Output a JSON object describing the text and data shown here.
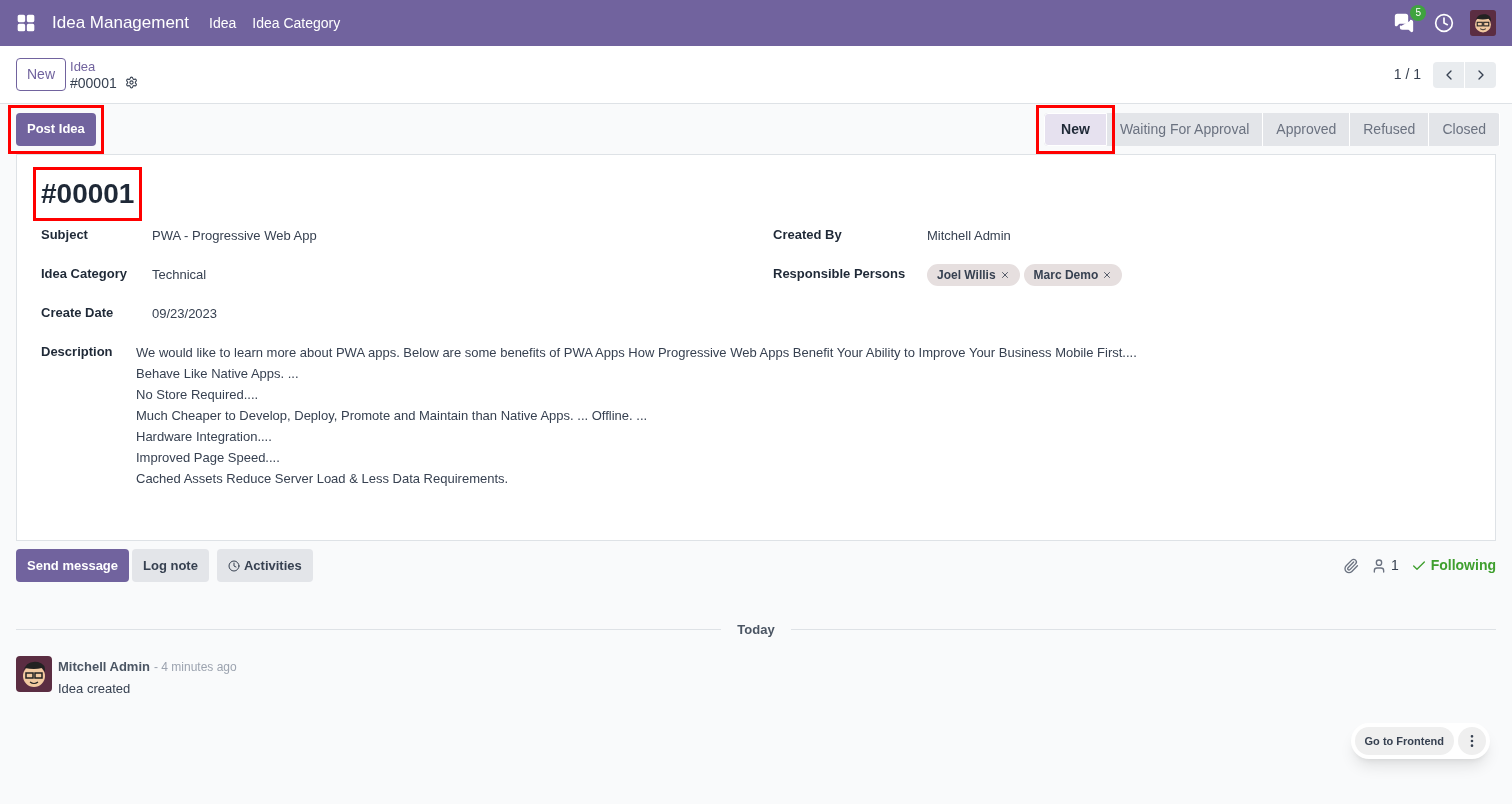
{
  "navbar": {
    "app_name": "Idea Management",
    "menus": [
      "Idea",
      "Idea Category"
    ],
    "message_count": "5"
  },
  "control_panel": {
    "new_button": "New",
    "breadcrumb": "Idea",
    "record_name": "#00001",
    "pager": "1 / 1"
  },
  "status_bar": {
    "post_button": {
      "label": "Post Idea",
      "annotated": true
    },
    "stages": [
      {
        "label": "New",
        "selected": true,
        "annotated": true
      },
      {
        "label": "Waiting For Approval",
        "selected": false,
        "annotated": false
      },
      {
        "label": "Approved",
        "selected": false,
        "annotated": false
      },
      {
        "label": "Refused",
        "selected": false,
        "annotated": false
      },
      {
        "label": "Closed",
        "selected": false,
        "annotated": false
      }
    ]
  },
  "form": {
    "title": {
      "text": "#00001",
      "annotated": true
    },
    "left_fields": [
      {
        "label": "Subject",
        "value": "PWA - Progressive Web App"
      },
      {
        "label": "Idea Category",
        "value": "Technical"
      },
      {
        "label": "Create Date",
        "value": "09/23/2023"
      }
    ],
    "created_by": {
      "label": "Created By",
      "value": "Mitchell Admin"
    },
    "responsible": {
      "label": "Responsible Persons",
      "tags": [
        "Joel Willis",
        "Marc Demo"
      ]
    },
    "description": {
      "label": "Description",
      "lines": [
        "We would like to learn more about PWA apps. Below are some benefits of PWA Apps How Progressive Web Apps Benefit Your Ability to Improve Your Business Mobile First....",
        "Behave Like Native Apps. ...",
        "No Store Required....",
        "Much Cheaper to Develop, Deploy, Promote and Maintain than Native Apps. ... Offline. ...",
        "Hardware Integration....",
        "Improved Page Speed....",
        "Cached Assets Reduce Server Load & Less Data Requirements."
      ]
    }
  },
  "chatter": {
    "buttons": [
      "Send message",
      "Log note",
      "Activities"
    ],
    "follower_count": "1",
    "following": "Following",
    "date_separator": "Today",
    "messages": [
      {
        "author": "Mitchell Admin",
        "time": "- 4 minutes ago",
        "body": "Idea created"
      }
    ]
  },
  "floating": {
    "button": "Go to Frontend"
  }
}
